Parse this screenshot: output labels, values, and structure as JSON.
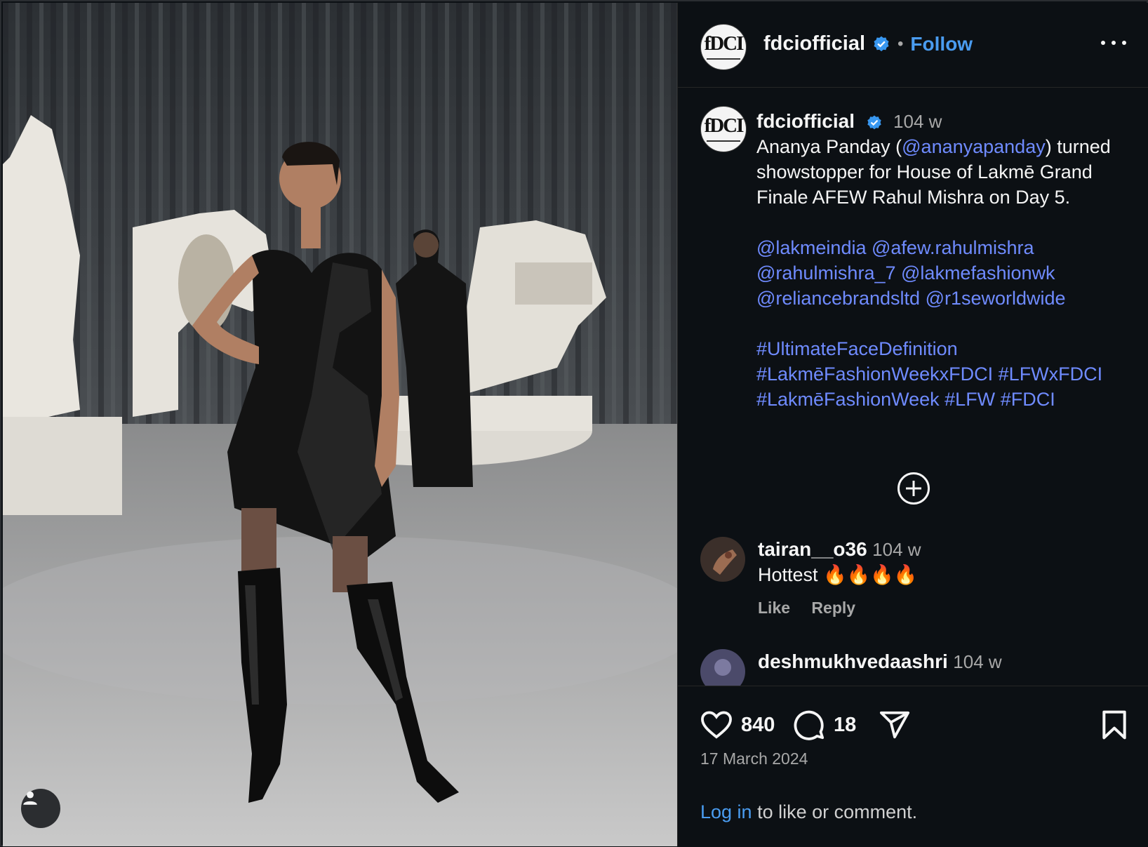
{
  "post": {
    "username": "fdciofficial",
    "follow_label": "Follow",
    "separator": "•",
    "avatar_logo": "fDCI",
    "more_label": "More options"
  },
  "caption": {
    "username": "fdciofficial",
    "time": "104 w",
    "line1_pre": "Ananya Panday (",
    "line1_mention": "@ananyapanday",
    "line1_post": ")",
    "line2": "turned showstopper for House of Lakmē Grand Finale AFEW Rahul Mishra on Day 5.",
    "mentions": [
      "@lakmeindia",
      "@afew.rahulmishra",
      "@rahulmishra_7",
      "@lakmefashionwk",
      "@reliancebrandsltd",
      "@r1seworldwide"
    ],
    "hashtags": [
      "#UltimateFaceDefinition",
      "#LakmēFashionWeekxFDCI",
      "#LFWxFDCI",
      "#LakmēFashionWeek",
      "#LFW",
      "#FDCI"
    ]
  },
  "comments": [
    {
      "username": "tairan__o36",
      "time": "104 w",
      "text": "Hottest 🔥🔥🔥🔥",
      "like_label": "Like",
      "reply_label": "Reply"
    },
    {
      "username": "deshmukhvedaashri",
      "time": "104 w"
    }
  ],
  "footer": {
    "likes": "840",
    "comments": "18",
    "date": "17 March 2024",
    "login_link": "Log in",
    "login_rest": " to like or comment."
  },
  "icons": [
    "user-tag-icon",
    "verified-badge-icon",
    "more-icon",
    "load-more-comments-icon",
    "heart-icon",
    "comment-icon",
    "share-icon",
    "bookmark-icon"
  ],
  "colors": {
    "background": "#0c1014",
    "link": "#6f8bff",
    "follow": "#4a9cf0",
    "verified": "#3897f0"
  }
}
